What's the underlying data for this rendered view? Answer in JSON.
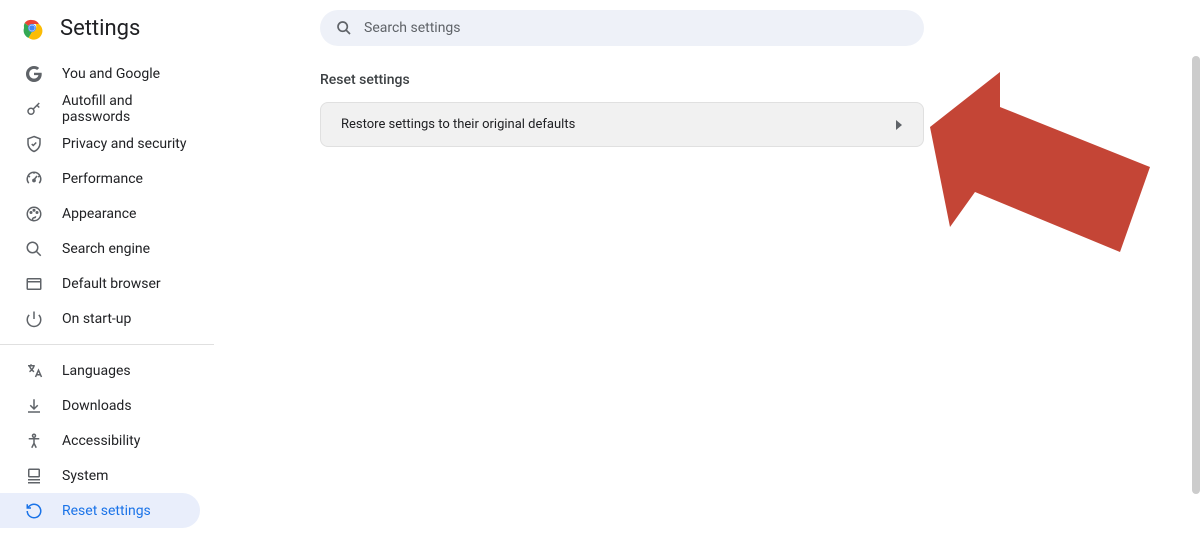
{
  "header": {
    "title": "Settings"
  },
  "search": {
    "placeholder": "Search settings"
  },
  "sidebar": {
    "items": [
      {
        "label": "You and Google",
        "icon": "google"
      },
      {
        "label": "Autofill and passwords",
        "icon": "key"
      },
      {
        "label": "Privacy and security",
        "icon": "shield"
      },
      {
        "label": "Performance",
        "icon": "speedometer"
      },
      {
        "label": "Appearance",
        "icon": "paint"
      },
      {
        "label": "Search engine",
        "icon": "search"
      },
      {
        "label": "Default browser",
        "icon": "browser"
      },
      {
        "label": "On start-up",
        "icon": "power"
      }
    ],
    "items2": [
      {
        "label": "Languages",
        "icon": "translate"
      },
      {
        "label": "Downloads",
        "icon": "download"
      },
      {
        "label": "Accessibility",
        "icon": "accessibility"
      },
      {
        "label": "System",
        "icon": "system"
      },
      {
        "label": "Reset settings",
        "icon": "reset",
        "active": true
      }
    ]
  },
  "main": {
    "section_title": "Reset settings",
    "option_label": "Restore settings to their original defaults"
  },
  "colors": {
    "accent": "#1a73e8",
    "annotation": "#c44536"
  }
}
